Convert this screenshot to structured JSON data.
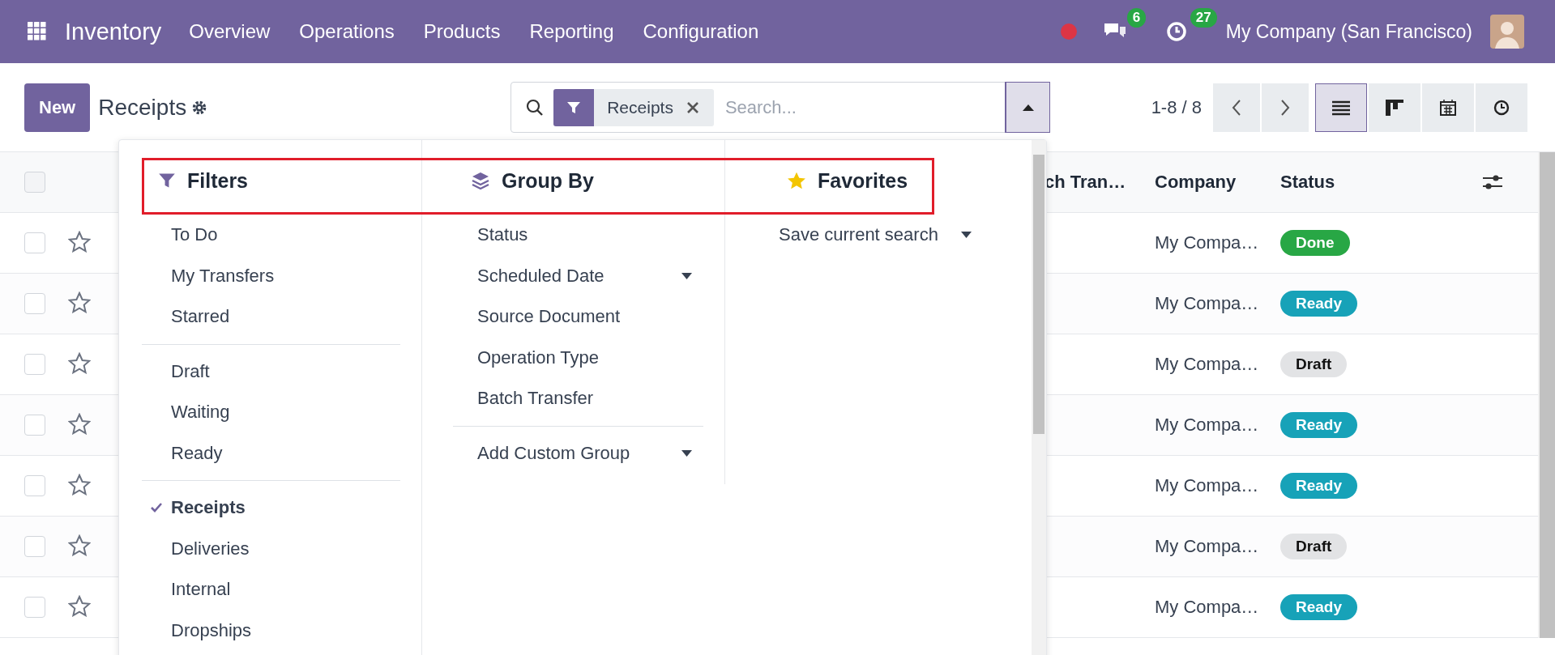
{
  "navbar": {
    "app_name": "Inventory",
    "menu": [
      "Overview",
      "Operations",
      "Products",
      "Reporting",
      "Configuration"
    ],
    "messages_count": "6",
    "activities_count": "27",
    "company": "My Company (San Francisco)"
  },
  "control_panel": {
    "new_button": "New",
    "title": "Receipts",
    "search": {
      "facet": "Receipts",
      "placeholder": "Search..."
    },
    "pager": "1-8 / 8",
    "views": [
      {
        "kind": "list",
        "selected": true
      },
      {
        "kind": "kanban",
        "selected": false
      },
      {
        "kind": "calendar",
        "selected": false
      },
      {
        "kind": "activity",
        "selected": false
      }
    ]
  },
  "table": {
    "all_checked": false,
    "columns": [
      "ch Tran…",
      "Company",
      "Status"
    ],
    "rows": [
      {
        "checked": false,
        "company": "My Compa…",
        "status": "Done",
        "kind": "done"
      },
      {
        "checked": false,
        "company": "My Compa…",
        "status": "Ready",
        "kind": "ready"
      },
      {
        "checked": false,
        "company": "My Compa…",
        "status": "Draft",
        "kind": "draft"
      },
      {
        "checked": false,
        "company": "My Compa…",
        "status": "Ready",
        "kind": "ready"
      },
      {
        "checked": false,
        "company": "My Compa…",
        "status": "Ready",
        "kind": "ready"
      },
      {
        "checked": false,
        "company": "My Compa…",
        "status": "Draft",
        "kind": "draft"
      },
      {
        "checked": false,
        "company": "My Compa…",
        "status": "Ready",
        "kind": "ready"
      }
    ]
  },
  "search_panel": {
    "filters": {
      "title": "Filters",
      "groups": [
        [
          {
            "label": "To Do",
            "selected": false
          },
          {
            "label": "My Transfers",
            "selected": false
          },
          {
            "label": "Starred",
            "selected": false
          }
        ],
        [
          {
            "label": "Draft",
            "selected": false
          },
          {
            "label": "Waiting",
            "selected": false
          },
          {
            "label": "Ready",
            "selected": false
          }
        ],
        [
          {
            "label": "Receipts",
            "selected": true
          },
          {
            "label": "Deliveries",
            "selected": false
          },
          {
            "label": "Internal",
            "selected": false
          },
          {
            "label": "Dropships",
            "selected": false
          }
        ]
      ]
    },
    "group_by": {
      "title": "Group By",
      "items": [
        {
          "label": "Status",
          "submenu": false
        },
        {
          "label": "Scheduled Date",
          "submenu": true
        },
        {
          "label": "Source Document",
          "submenu": false
        },
        {
          "label": "Operation Type",
          "submenu": false
        },
        {
          "label": "Batch Transfer",
          "submenu": false
        }
      ],
      "custom": "Add Custom Group"
    },
    "favorites": {
      "title": "Favorites",
      "items": [
        {
          "label": "Save current search",
          "submenu": true
        }
      ]
    }
  }
}
